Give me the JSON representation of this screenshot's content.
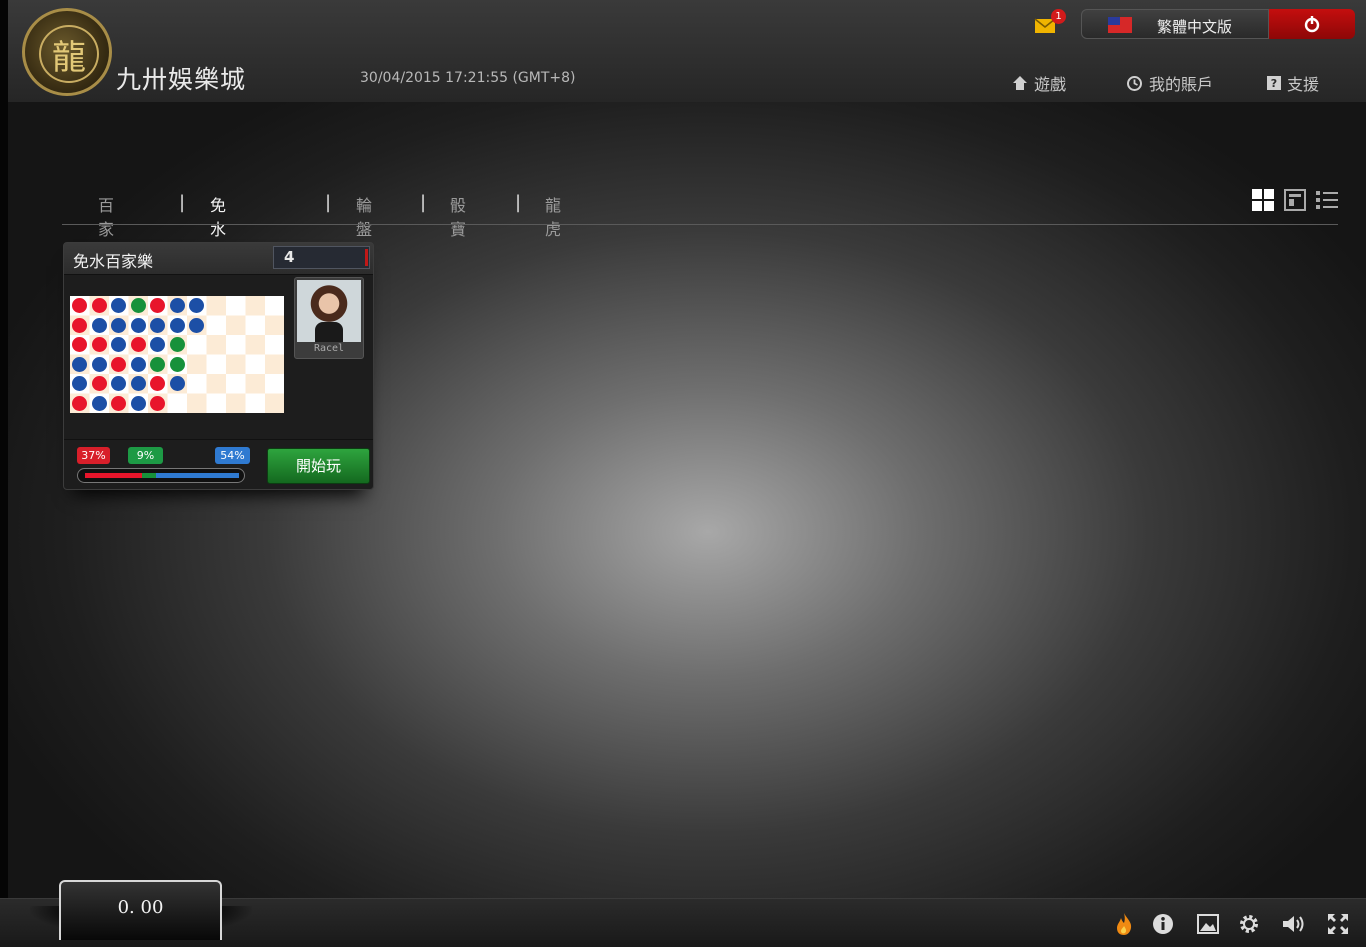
{
  "header": {
    "brand": "九卅娛樂城",
    "logo_icon_glyph": "龍",
    "datetime": "30/04/2015 17:21:55 (GMT+8)",
    "mail_badge": "1",
    "language": "繁體中文版",
    "nav": [
      {
        "label": "遊戲",
        "icon": "home-icon"
      },
      {
        "label": "我的賬戶",
        "icon": "history-icon"
      },
      {
        "label": "支援",
        "icon": "help-icon"
      }
    ]
  },
  "tabs": [
    {
      "label": "百家樂",
      "active": false
    },
    {
      "label": "免水百家樂",
      "active": true
    },
    {
      "label": "輪盤",
      "active": false
    },
    {
      "label": "骰寶",
      "active": false
    },
    {
      "label": "龍虎",
      "active": false
    }
  ],
  "tab_separator": "|",
  "view_modes": [
    "grid-view-icon",
    "panel-view-icon",
    "list-view-icon"
  ],
  "table_card": {
    "title": "免水百家樂",
    "count": "4",
    "dealer_name": "Racel",
    "road": [
      [
        "r",
        "r",
        "r",
        "b",
        "b",
        "r"
      ],
      [
        "r",
        "b",
        "r",
        "b",
        "r",
        "b"
      ],
      [
        "b",
        "b",
        "b",
        "r",
        "b",
        "r"
      ],
      [
        "g",
        "b",
        "r",
        "b",
        "b",
        "b"
      ],
      [
        "r",
        "b",
        "b",
        "g",
        "r",
        "r"
      ],
      [
        "b",
        "b",
        "g",
        "g",
        "b",
        ""
      ],
      [
        "b",
        "b",
        "",
        "",
        "",
        ""
      ]
    ],
    "stats": {
      "banker_pct": "37%",
      "tie_pct": "9%",
      "player_pct": "54%",
      "banker": 37,
      "tie": 9,
      "player": 54
    },
    "play_label": "開始玩"
  },
  "footer": {
    "balance": "0. 00",
    "tools": [
      "flame-icon",
      "info-icon",
      "image-icon",
      "settings-icon",
      "volume-icon",
      "fullscreen-icon"
    ]
  },
  "colors": {
    "red": "#e8152b",
    "blue": "#1c4fa6",
    "green": "#17913a",
    "power_red": "#c40e0e",
    "play_green": "#2ea43e"
  }
}
